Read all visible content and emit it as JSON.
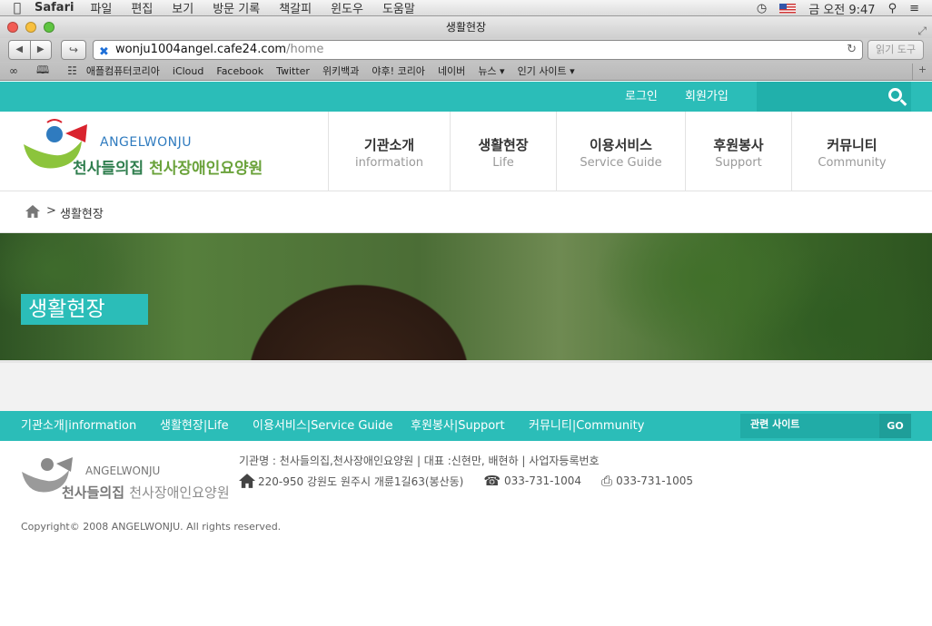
{
  "menubar": {
    "app": "Safari",
    "items": [
      "파일",
      "편집",
      "보기",
      "방문 기록",
      "책갈피",
      "윈도우",
      "도움말"
    ],
    "clock": "금 오전 9:47"
  },
  "window": {
    "title": "생활현장",
    "url_host": "wonju1004angel.cafe24.com",
    "url_path": "/home",
    "reader_label": "읽기 도구"
  },
  "bookmarks": [
    "애플컴퓨터코리아",
    "iCloud",
    "Facebook",
    "Twitter",
    "위키백과",
    "야후! 코리아",
    "네이버",
    "뉴스 ▾",
    "인기 사이트 ▾"
  ],
  "site": {
    "topbar": {
      "login": "로그인",
      "join": "회원가입"
    },
    "logo": {
      "en_a": "ANGEL",
      "en_b": "WONJU",
      "ko_a": "천사들의집 ",
      "ko_b": "천사장애인요양원"
    },
    "nav": [
      {
        "ko": "기관소개",
        "en": "information"
      },
      {
        "ko": "생활현장",
        "en": "Life"
      },
      {
        "ko": "이용서비스",
        "en": "Service Guide"
      },
      {
        "ko": "후원봉사",
        "en": "Support"
      },
      {
        "ko": "커뮤니티",
        "en": "Community"
      }
    ],
    "breadcrumb": {
      "sep": ">",
      "current": "생활현장"
    },
    "hero_title": "생활현장",
    "footnav": [
      "기관소개|information",
      "생활현장|Life",
      "이용서비스|Service Guide",
      "후원봉사|Support",
      "커뮤니티|Community"
    ],
    "related_label": "관련 사이트",
    "go_label": "GO",
    "footer": {
      "logo_en": "ANGELWONJU",
      "logo_ko_a": "천사들의집 ",
      "logo_ko_b": "천사장애인요양원",
      "info": "기관명 : 천사들의집,천사장애인요양원 | 대표 :신현만, 배현하 | 사업자등록번호",
      "address": "220-950 강원도 원주시 개륜1길63(봉산동)",
      "phone": "033-731-1004",
      "fax": "033-731-1005",
      "copyright": "Copyright© 2008 ANGELWONJU. All rights reserved."
    }
  },
  "colors": {
    "accent": "#2bbdb8",
    "accent_dark": "#21b0ab",
    "logo_green": "#6aa23a",
    "logo_blue": "#2f7bbf"
  }
}
